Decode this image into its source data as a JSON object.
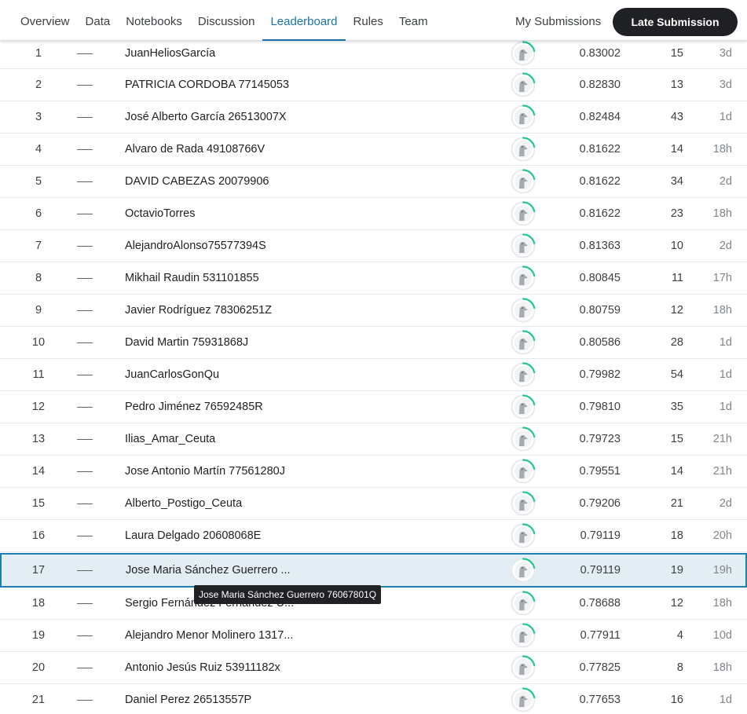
{
  "nav": {
    "tabs": [
      {
        "label": "Overview"
      },
      {
        "label": "Data"
      },
      {
        "label": "Notebooks"
      },
      {
        "label": "Discussion"
      },
      {
        "label": "Leaderboard"
      },
      {
        "label": "Rules"
      },
      {
        "label": "Team"
      }
    ],
    "active_tab": "Leaderboard",
    "my_submissions": "My Submissions",
    "late_submission": "Late Submission"
  },
  "avatar_icon": "default-user-avatar-icon",
  "colors": {
    "accent": "#1a73a8",
    "highlight_bg": "#e3eef4",
    "highlight_border": "#1f7fb0",
    "ring": "#20c98b"
  },
  "leaderboard": [
    {
      "rank": "1",
      "delta": "—",
      "name": "JuanHeliosGarcía",
      "score": "0.83002",
      "entries": "15",
      "last": "3d"
    },
    {
      "rank": "2",
      "delta": "—",
      "name": "PATRICIA CORDOBA 77145053",
      "score": "0.82830",
      "entries": "13",
      "last": "3d"
    },
    {
      "rank": "3",
      "delta": "—",
      "name": "José Alberto García 26513007X",
      "score": "0.82484",
      "entries": "43",
      "last": "1d"
    },
    {
      "rank": "4",
      "delta": "—",
      "name": "Alvaro de Rada 49108766V",
      "score": "0.81622",
      "entries": "14",
      "last": "18h"
    },
    {
      "rank": "5",
      "delta": "—",
      "name": "DAVID CABEZAS 20079906",
      "score": "0.81622",
      "entries": "34",
      "last": "2d"
    },
    {
      "rank": "6",
      "delta": "—",
      "name": "OctavioTorres",
      "score": "0.81622",
      "entries": "23",
      "last": "18h"
    },
    {
      "rank": "7",
      "delta": "—",
      "name": "AlejandroAlonso75577394S",
      "score": "0.81363",
      "entries": "10",
      "last": "2d"
    },
    {
      "rank": "8",
      "delta": "—",
      "name": "Mikhail Raudin 531101855",
      "score": "0.80845",
      "entries": "11",
      "last": "17h"
    },
    {
      "rank": "9",
      "delta": "—",
      "name": "Javier Rodríguez 78306251Z",
      "score": "0.80759",
      "entries": "12",
      "last": "18h"
    },
    {
      "rank": "10",
      "delta": "—",
      "name": "David Martin 75931868J",
      "score": "0.80586",
      "entries": "28",
      "last": "1d"
    },
    {
      "rank": "11",
      "delta": "—",
      "name": "JuanCarlosGonQu",
      "score": "0.79982",
      "entries": "54",
      "last": "1d"
    },
    {
      "rank": "12",
      "delta": "—",
      "name": "Pedro Jiménez 76592485R",
      "score": "0.79810",
      "entries": "35",
      "last": "1d"
    },
    {
      "rank": "13",
      "delta": "—",
      "name": "Ilias_Amar_Ceuta",
      "score": "0.79723",
      "entries": "15",
      "last": "21h"
    },
    {
      "rank": "14",
      "delta": "—",
      "name": "Jose Antonio Martín 77561280J",
      "score": "0.79551",
      "entries": "14",
      "last": "21h"
    },
    {
      "rank": "15",
      "delta": "—",
      "name": "Alberto_Postigo_Ceuta",
      "score": "0.79206",
      "entries": "21",
      "last": "2d"
    },
    {
      "rank": "16",
      "delta": "—",
      "name": "Laura Delgado 20608068E",
      "score": "0.79119",
      "entries": "18",
      "last": "20h"
    },
    {
      "rank": "17",
      "delta": "—",
      "name": "Jose Maria Sánchez Guerrero ...",
      "score": "0.79119",
      "entries": "19",
      "last": "19h"
    },
    {
      "rank": "18",
      "delta": "—",
      "name": "Sergio Fernández Fernández U...",
      "score": "0.78688",
      "entries": "12",
      "last": "18h"
    },
    {
      "rank": "19",
      "delta": "—",
      "name": "Alejandro Menor Molinero 1317...",
      "score": "0.77911",
      "entries": "4",
      "last": "10d"
    },
    {
      "rank": "20",
      "delta": "—",
      "name": "Antonio Jesús Ruiz 53911182x",
      "score": "0.77825",
      "entries": "8",
      "last": "18h"
    },
    {
      "rank": "21",
      "delta": "—",
      "name": "Daniel Perez 26513557P",
      "score": "0.77653",
      "entries": "16",
      "last": "1d"
    }
  ],
  "highlighted_rank": "17",
  "tooltip": "Jose Maria Sánchez Guerrero 76067801Q"
}
